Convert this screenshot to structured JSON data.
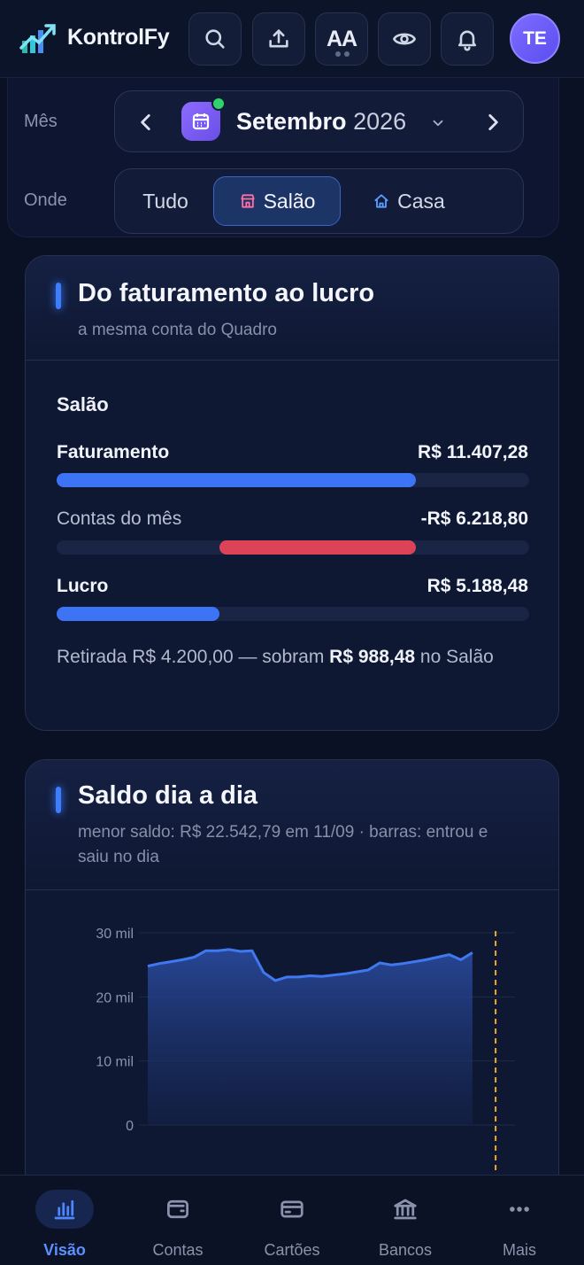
{
  "header": {
    "brand": "KontrolFy",
    "font_toggle_label": "AA",
    "avatar_initials": "TE"
  },
  "filters": {
    "month_label": "Mês",
    "month_name": "Setembro",
    "year": "2026",
    "where_label": "Onde",
    "options": [
      "Tudo",
      "Salão",
      "Casa"
    ],
    "selected": "Salão"
  },
  "profit_card": {
    "title": "Do faturamento ao lucro",
    "subtitle": "a mesma conta do Quadro",
    "section": "Salão",
    "rows": [
      {
        "label": "Faturamento",
        "value": "R$ 11.407,28",
        "bar_start": 0,
        "bar_end": 0.76,
        "color": "#3d74f5"
      },
      {
        "label": "Contas do mês",
        "value": "-R$ 6.218,80",
        "bar_start": 0.345,
        "bar_end": 0.76,
        "color": "#dc4358"
      },
      {
        "label": "Lucro",
        "value": "R$ 5.188,48",
        "bar_start": 0,
        "bar_end": 0.345,
        "color": "#3d74f5"
      }
    ],
    "note_prefix": "Retirada R$ 4.200,00 — sobram ",
    "note_bold": "R$ 988,48",
    "note_suffix": " no Salão"
  },
  "balance_card": {
    "title": "Saldo dia a dia",
    "subtitle": "menor saldo: R$ 22.542,79 em 11/09 · barras: entrou e saiu no dia"
  },
  "chart_data": {
    "type": "area",
    "title": "Saldo dia a dia",
    "x": [
      1,
      2,
      3,
      4,
      5,
      6,
      7,
      8,
      9,
      10,
      11,
      12,
      13,
      14,
      15,
      16,
      17,
      18,
      19,
      20,
      21,
      22,
      23,
      24,
      25,
      26,
      27,
      28,
      29,
      30
    ],
    "y": [
      24800,
      25200,
      25500,
      25800,
      26200,
      27200,
      27200,
      27400,
      27100,
      27200,
      23800,
      22543,
      23100,
      23100,
      23300,
      23200,
      23400,
      23600,
      23900,
      24200,
      25300,
      25000,
      25200,
      25500,
      25800,
      26200,
      26600,
      25800,
      26900,
      null
    ],
    "yticks": [
      "30 mil",
      "20 mil",
      "10 mil",
      "0"
    ],
    "ylim": [
      0,
      30000
    ],
    "xlim": [
      1,
      30
    ],
    "today_marker_x": 31,
    "grid": true,
    "line_color": "#3f78f0",
    "marker_color": "#f0a92a"
  },
  "bottom_nav": {
    "items": [
      {
        "label": "Visão",
        "icon": "chart-bars-icon"
      },
      {
        "label": "Contas",
        "icon": "wallet-icon"
      },
      {
        "label": "Cartões",
        "icon": "credit-card-icon"
      },
      {
        "label": "Bancos",
        "icon": "bank-icon"
      },
      {
        "label": "Mais",
        "icon": "more-dots-icon"
      }
    ],
    "active": "Visão"
  }
}
